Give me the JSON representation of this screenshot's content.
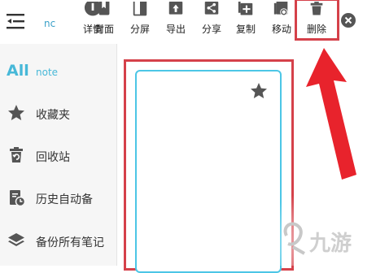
{
  "toolbar": {
    "nc_text": "nc",
    "items": [
      {
        "label": "详情",
        "icon": "info-icon"
      },
      {
        "label": "封面",
        "icon": "bookmark-icon"
      },
      {
        "label": "分屏",
        "icon": "split-screen-icon"
      },
      {
        "label": "导出",
        "icon": "export-icon"
      },
      {
        "label": "分享",
        "icon": "share-icon"
      },
      {
        "label": "复制",
        "icon": "copy-icon"
      },
      {
        "label": "移动",
        "icon": "move-icon"
      },
      {
        "label": "删除",
        "icon": "trash-icon"
      }
    ]
  },
  "sidebar": {
    "all": {
      "big": "All",
      "small": "note"
    },
    "items": [
      {
        "label": "收藏夹",
        "icon": "star-icon"
      },
      {
        "label": "回收站",
        "icon": "recycle-bin-icon"
      },
      {
        "label": "历史自动备",
        "icon": "history-backup-icon"
      },
      {
        "label": "备份所有笔记",
        "icon": "layers-icon"
      }
    ]
  },
  "colors": {
    "accent": "#47b8d8",
    "highlight": "#d5414a",
    "card_border": "#4cc6e6"
  },
  "watermark": {
    "text": "九游"
  }
}
